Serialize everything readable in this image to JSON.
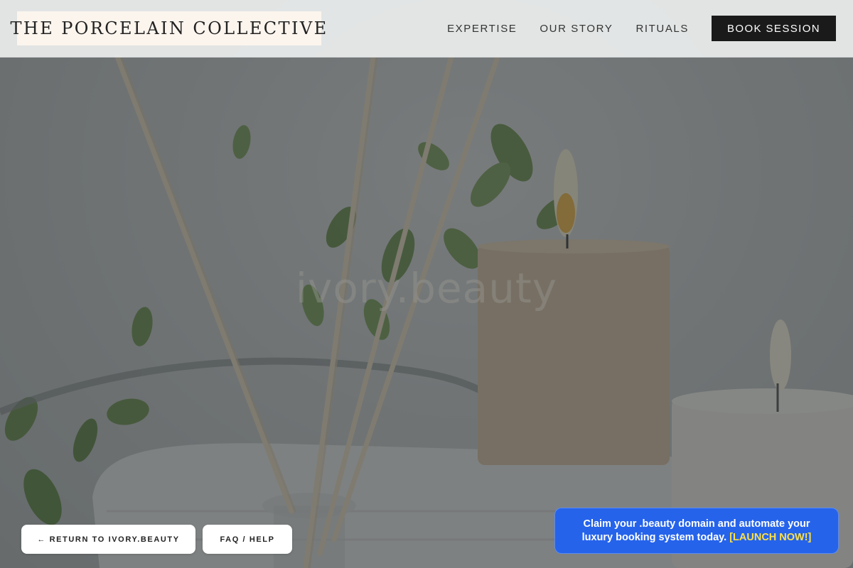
{
  "header": {
    "brand": "THE PORCELAIN COLLECTIVE",
    "nav": [
      {
        "label": "EXPERTISE"
      },
      {
        "label": "OUR STORY"
      },
      {
        "label": "RITUALS"
      }
    ],
    "cta_label": "BOOK SESSION"
  },
  "hero": {
    "watermark": "ivory.beauty"
  },
  "footer_actions": {
    "return_label": "← RETURN TO IVORY.BEAUTY",
    "faq_label": "FAQ / HELP"
  },
  "promo": {
    "text": "Claim your .beauty domain and automate your luxury booking system today.",
    "cta": "[LAUNCH NOW!]"
  },
  "colors": {
    "header_bg": "#e8e9e9",
    "logo_bg": "#fcf5ee",
    "cta_bg": "#1a1a1a",
    "promo_bg": "#2563eb",
    "promo_cta": "#fde047"
  },
  "icons": {
    "hero_scene": "spa-reed-diffuser-candles-photo"
  }
}
